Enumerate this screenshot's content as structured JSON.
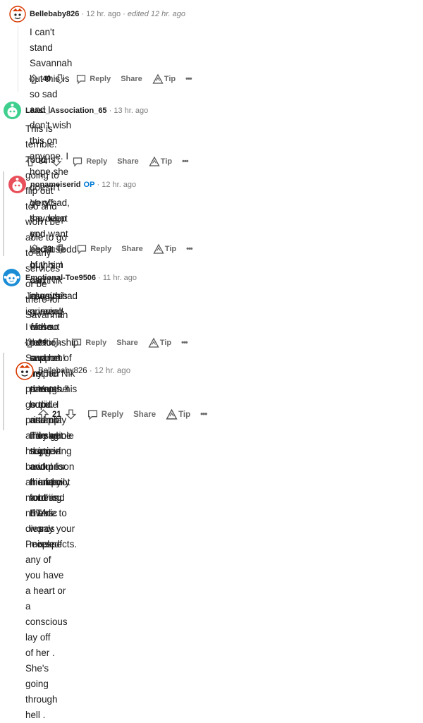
{
  "comments": [
    {
      "author": "Bellebaby826",
      "time": "12 hr. ago",
      "edited": "edited 12 hr. ago",
      "op_badge": "",
      "lines": [
        "I can't stand Savannah but this is so sad and I don't wish this on anyone. I hope she doesn't go off",
        "the deep end because of this. I can't imagine grieving without the support of my parents. I hope",
        "and pray they get support and therapy for this. ETA: words missed"
      ],
      "votes": "40",
      "avatar": "mascot-avatar"
    },
    {
      "author": "Least_Association_65",
      "time": "13 hr. ago",
      "edited": "",
      "op_badge": "",
      "lines": [
        "This is terrible. Todd is going to flip out too and won't be able to go to any services or be there for",
        "Savannah"
      ],
      "votes": "84",
      "avatar": "green-avatar"
    },
    {
      "author": "nonameiserid",
      "time": "12 hr. ago",
      "edited": "",
      "op_badge": "OP",
      "lines": [
        "Very sad, say what you want about Todd buy him and Nik always had a very close relationship",
        "and he helped Nik through his sucide attempt The whole thing is awful for his family and",
        "theirs"
      ],
      "votes": "73",
      "avatar": "red-avatar"
    },
    {
      "author": "Emotional-Toe9506",
      "time": "11 hr. ago",
      "edited": "",
      "op_badge": "",
      "lines": [
        "Jesus this is unreal! I feel so bad for Savanah! First her parents go to prison and she has to",
        "become an insta mom and now nic dies . People if any of you have a heart or a conscious lay off",
        "of her . She's going through hell ."
      ],
      "votes": "79",
      "avatar": "blue-avatar"
    },
    {
      "author": "Bellebaby826",
      "time": "12 hr. ago",
      "edited": "",
      "op_badge": "",
      "lines": [
        "Yep he did. I can't imagine grieving in prison and not being able to pay your respects."
      ],
      "votes": "21",
      "avatar": "mascot-avatar"
    }
  ],
  "actions": {
    "reply": "Reply",
    "share": "Share",
    "tip": "Tip",
    "more": "•••"
  },
  "colors": {
    "op": "#0079d3",
    "green_avatar": "#3ecf8e",
    "red_avatar": "#e8505b",
    "blue_avatar": "#1b8dd6",
    "mascot": "#d93a00"
  }
}
